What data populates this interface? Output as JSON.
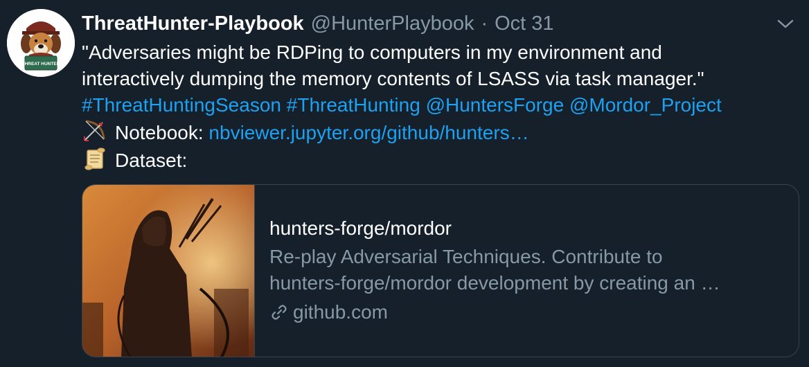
{
  "tweet": {
    "display_name": "ThreatHunter-Playbook",
    "handle": "@HunterPlaybook",
    "separator": "·",
    "date": "Oct 31",
    "avatar_text": "THREAT HUNTER",
    "text_line1": "\"Adversaries might be RDPing to computers in my environment and",
    "text_line2": "interactively dumping the memory contents of LSASS via task manager.\"",
    "hashtags": [
      "#ThreatHuntingSeason",
      "#ThreatHunting"
    ],
    "mentions": [
      "@HuntersForge",
      "@Mordor_Project"
    ],
    "notebook_label": "Notebook:",
    "notebook_link": "nbviewer.jupyter.org/github/hunters…",
    "dataset_label": "Dataset:",
    "notebook_emoji": "bow-and-arrow-icon",
    "dataset_emoji": "scroll-icon"
  },
  "card": {
    "title": "hunters-forge/mordor",
    "description_line1": "Re-play Adversarial Techniques. Contribute to",
    "description_line2": "hunters-forge/mordor development by creating an …",
    "domain": "github.com",
    "domain_icon": "link-icon"
  },
  "colors": {
    "background": "#15202b",
    "link": "#1da1f2",
    "secondary": "#8899a6",
    "border": "#38444d"
  }
}
